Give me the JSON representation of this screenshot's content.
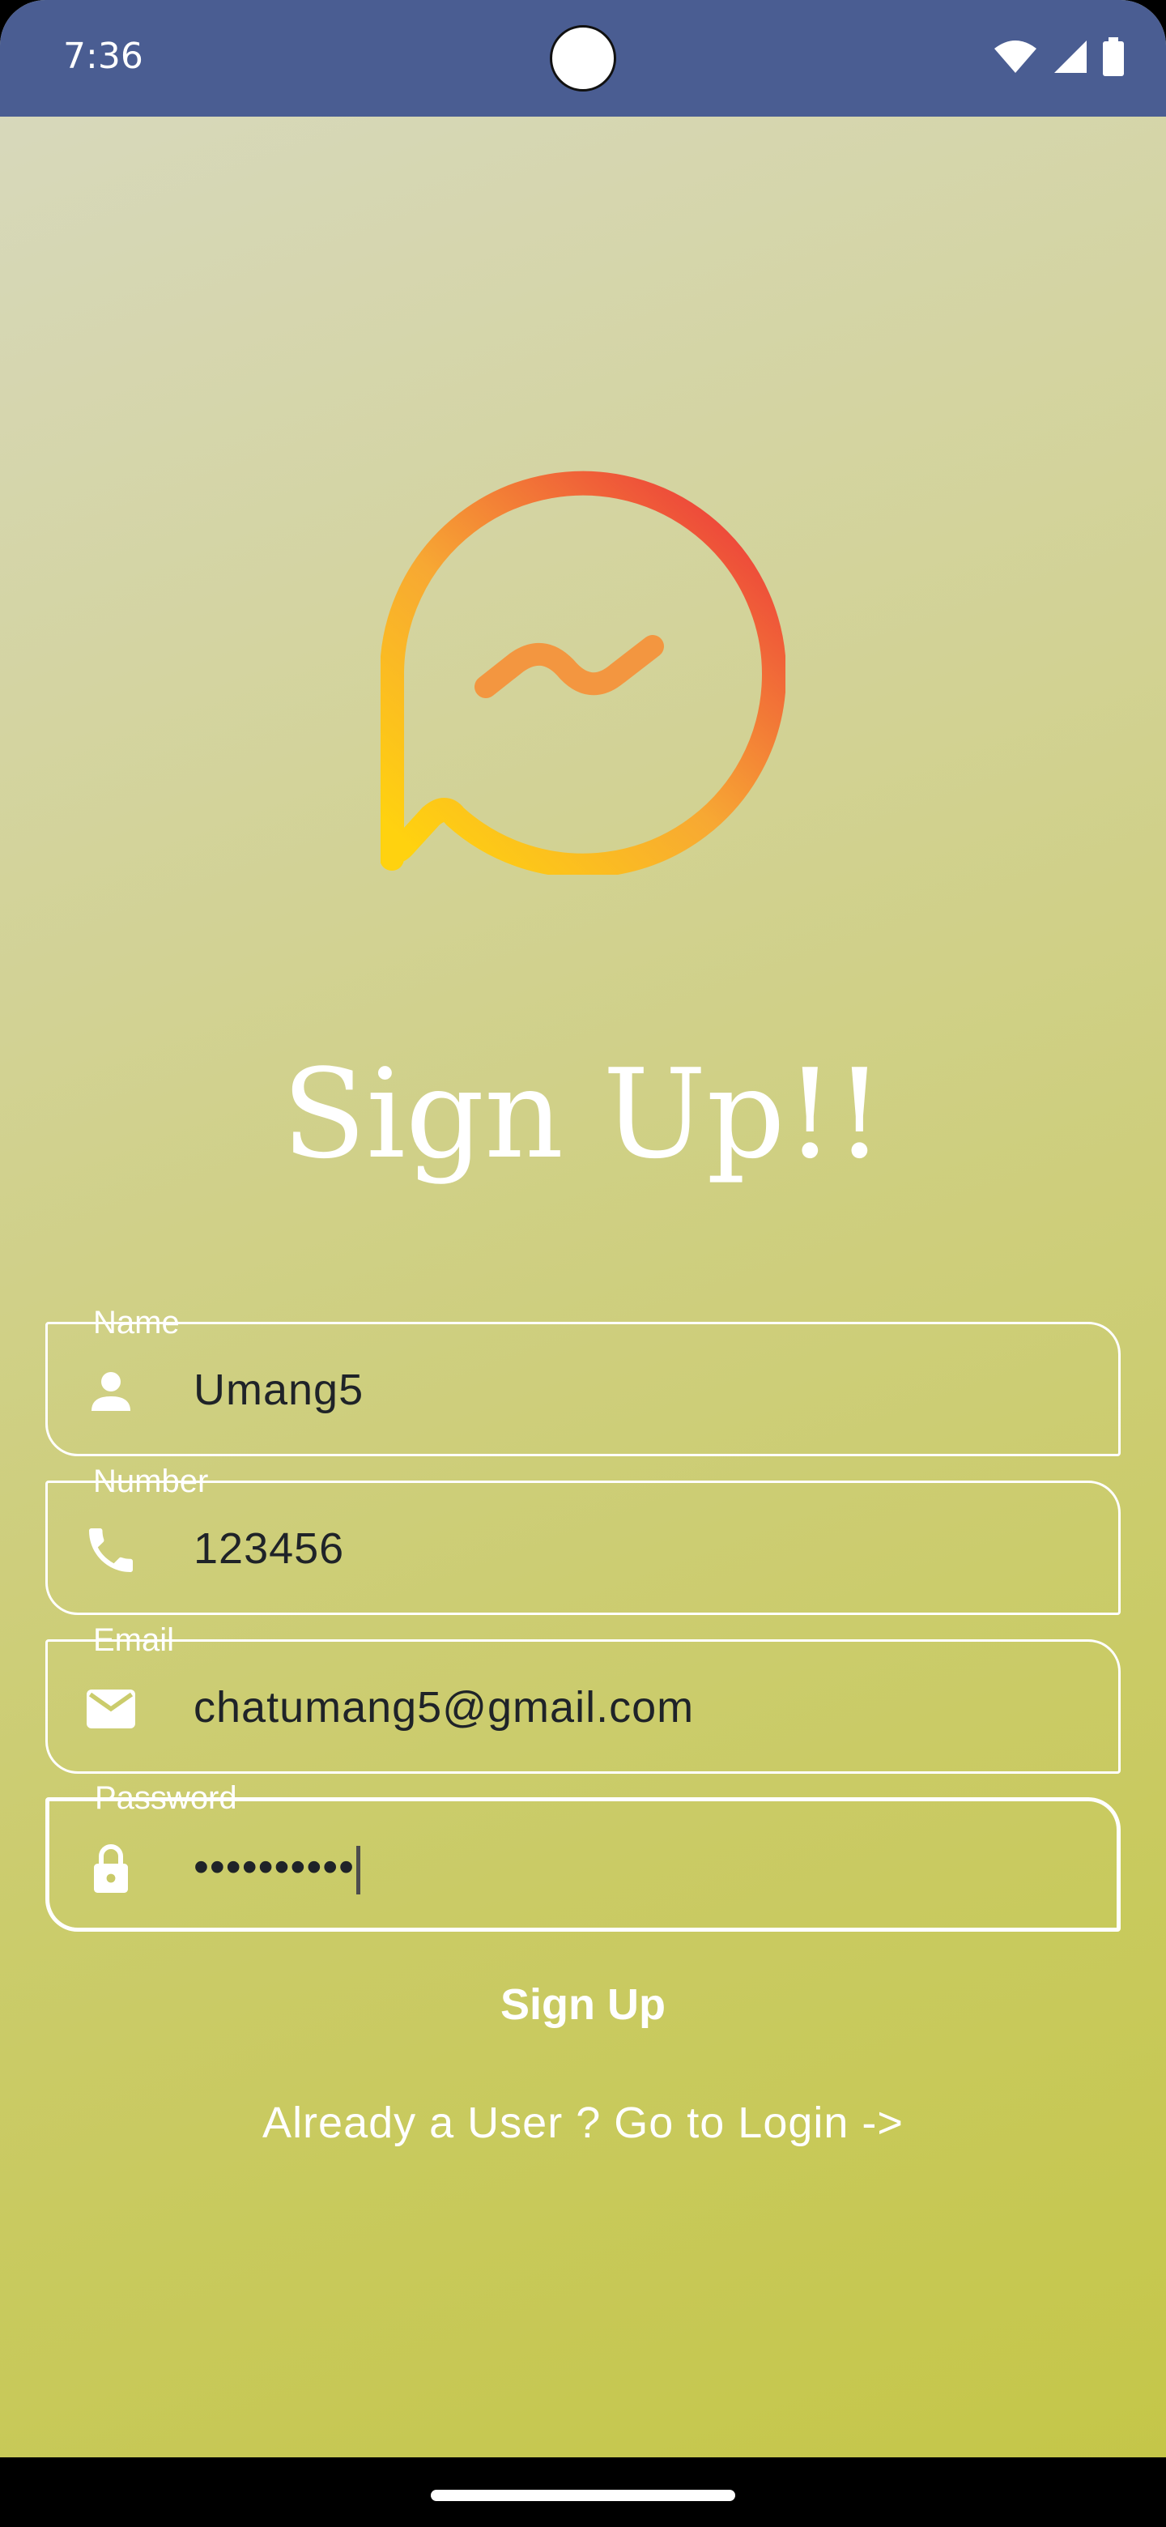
{
  "status_bar": {
    "time": "7:36",
    "icons": [
      "wifi-icon",
      "signal-icon",
      "battery-icon"
    ]
  },
  "app": {
    "logo": "chat-bubble-logo",
    "title": "Sign Up!!"
  },
  "form": {
    "fields": [
      {
        "label": "Name",
        "icon": "person-icon",
        "value": "Umang5"
      },
      {
        "label": "Number",
        "icon": "phone-icon",
        "value": "123456"
      },
      {
        "label": "Email",
        "icon": "mail-icon",
        "value": "chatumang5@gmail.com"
      },
      {
        "label": "Password",
        "icon": "lock-icon",
        "value": "••••••••••"
      }
    ],
    "submit_label": "Sign Up",
    "login_link": "Already a User ? Go to Login ->"
  },
  "colors": {
    "status_bar": "#4a5d92",
    "logo_gradient_start": "#ffcf0f",
    "logo_gradient_end": "#ec3b3b",
    "field_border": "#ffffff",
    "text_value": "#1f2328"
  }
}
